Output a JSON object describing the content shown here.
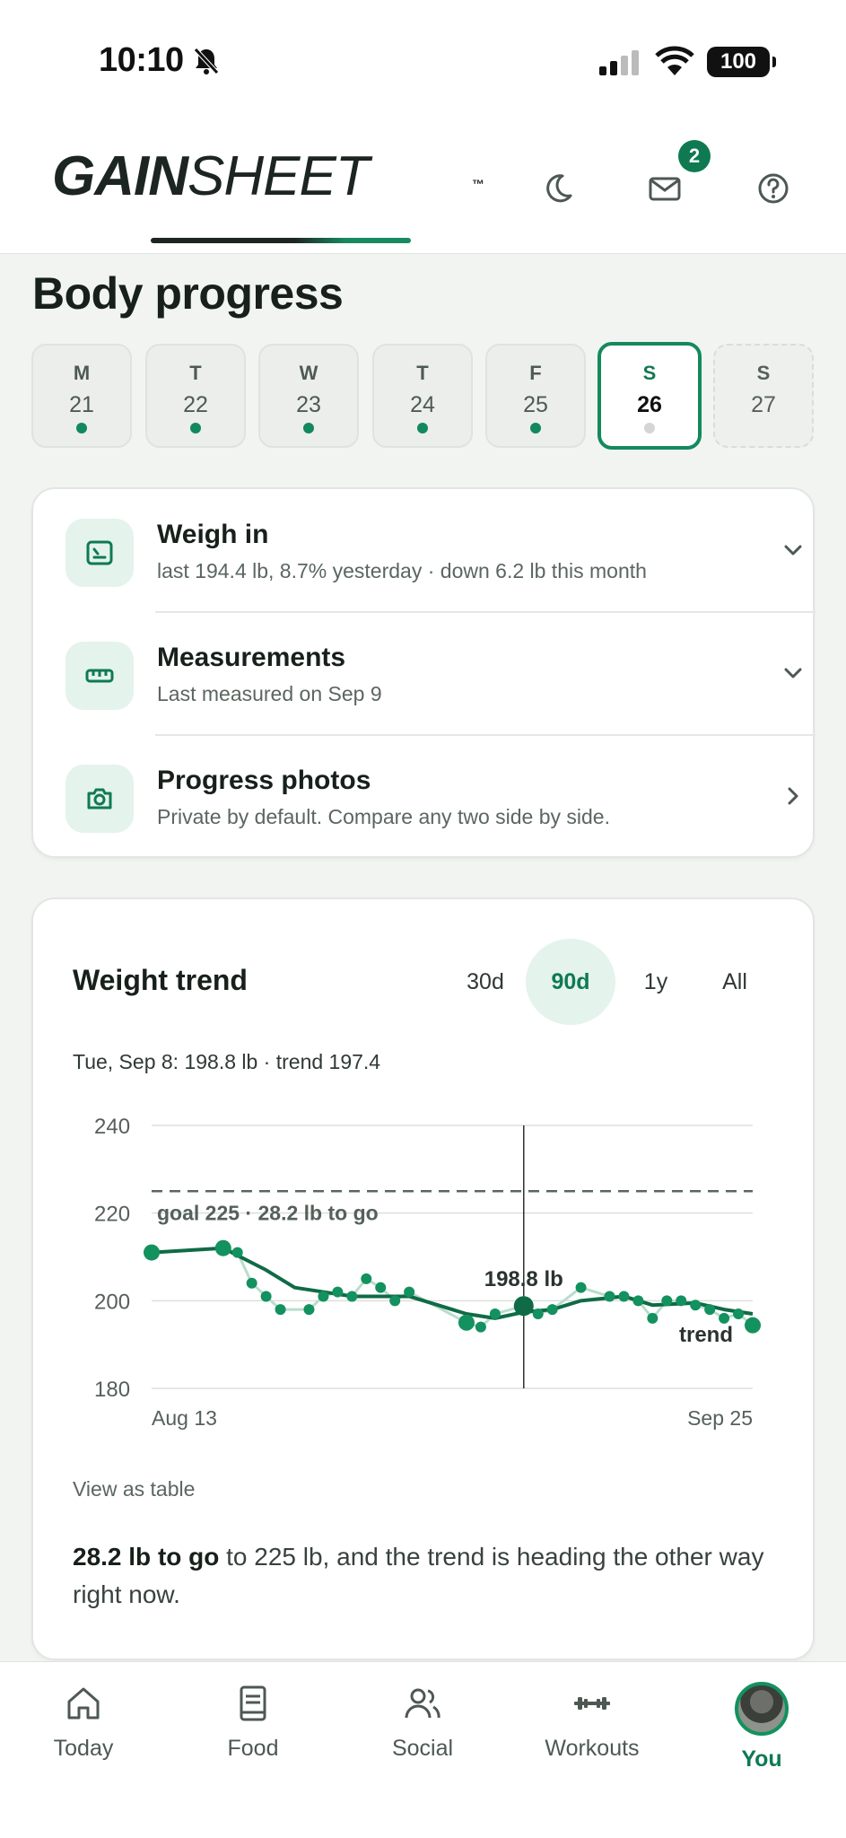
{
  "status_bar": {
    "time": "10:10",
    "battery": "100"
  },
  "header": {
    "logo_bold": "GAIN",
    "logo_light": "SHEET",
    "logo_tm": "™",
    "mail_badge": "2"
  },
  "page": {
    "title": "Body progress"
  },
  "days": [
    {
      "letter": "M",
      "num": "21",
      "logged": true
    },
    {
      "letter": "T",
      "num": "22",
      "logged": true
    },
    {
      "letter": "W",
      "num": "23",
      "logged": true
    },
    {
      "letter": "T",
      "num": "24",
      "logged": true
    },
    {
      "letter": "F",
      "num": "25",
      "logged": true
    },
    {
      "letter": "S",
      "num": "26",
      "logged": false
    },
    {
      "letter": "S",
      "num": "27",
      "logged": false
    }
  ],
  "log_card": {
    "weigh_in": {
      "title": "Weigh in",
      "subtitle": "last 194.4 lb, 8.7% yesterday · down 6.2 lb this month"
    },
    "measurements": {
      "title": "Measurements",
      "subtitle": "Last measured on Sep 9"
    },
    "photos": {
      "title": "Progress photos",
      "subtitle": "Private by default. Compare any two side by side."
    }
  },
  "trend_card": {
    "title": "Weight trend",
    "ranges": {
      "r30": "30d",
      "r90": "90d",
      "r1y": "1y",
      "all": "All"
    },
    "selected_range": "90d",
    "readout": "Tue, Sep 8: 198.8 lb · trend 197.4",
    "view_table": "View as table",
    "summary_bold": "28.2 lb to go",
    "summary_rest": " to 225 lb, and the trend is heading the other way right now."
  },
  "chart_data": {
    "type": "line",
    "ylim": [
      180,
      240
    ],
    "yticks": [
      "240",
      "220",
      "200",
      "180"
    ],
    "xlabels": [
      "Aug 13",
      "Sep 25"
    ],
    "goal": {
      "value": 225,
      "label": "goal 225 · 28.2 lb to go"
    },
    "cursor": {
      "x": 26,
      "value": 198.8,
      "label": "198.8 lb"
    },
    "trend_label": "trend",
    "series": [
      {
        "name": "weight",
        "x": [
          0,
          5,
          6,
          7,
          8,
          9,
          11,
          12,
          13,
          14,
          15,
          16,
          17,
          18,
          22,
          23,
          24,
          26,
          27,
          28,
          30,
          32,
          33,
          34,
          35,
          36,
          37,
          38,
          39,
          40,
          41,
          42
        ],
        "values": [
          211,
          212,
          211,
          204,
          201,
          198,
          198,
          201,
          202,
          201,
          205,
          203,
          200,
          202,
          195,
          194,
          197,
          198.8,
          197,
          198,
          203,
          201,
          201,
          200,
          196,
          200,
          200,
          199,
          198,
          196,
          197,
          194.4
        ]
      },
      {
        "name": "trend",
        "x": [
          0,
          5,
          8,
          10,
          12,
          14,
          16,
          18,
          20,
          22,
          24,
          26,
          28,
          30,
          33,
          35,
          38,
          40,
          42
        ],
        "values": [
          211,
          212,
          207,
          203,
          202,
          201,
          201,
          201,
          199,
          197,
          196,
          197.4,
          198,
          200,
          201,
          199,
          199.5,
          198,
          197
        ]
      }
    ]
  },
  "nav": {
    "today": "Today",
    "food": "Food",
    "social": "Social",
    "workouts": "Workouts",
    "you": "You"
  }
}
